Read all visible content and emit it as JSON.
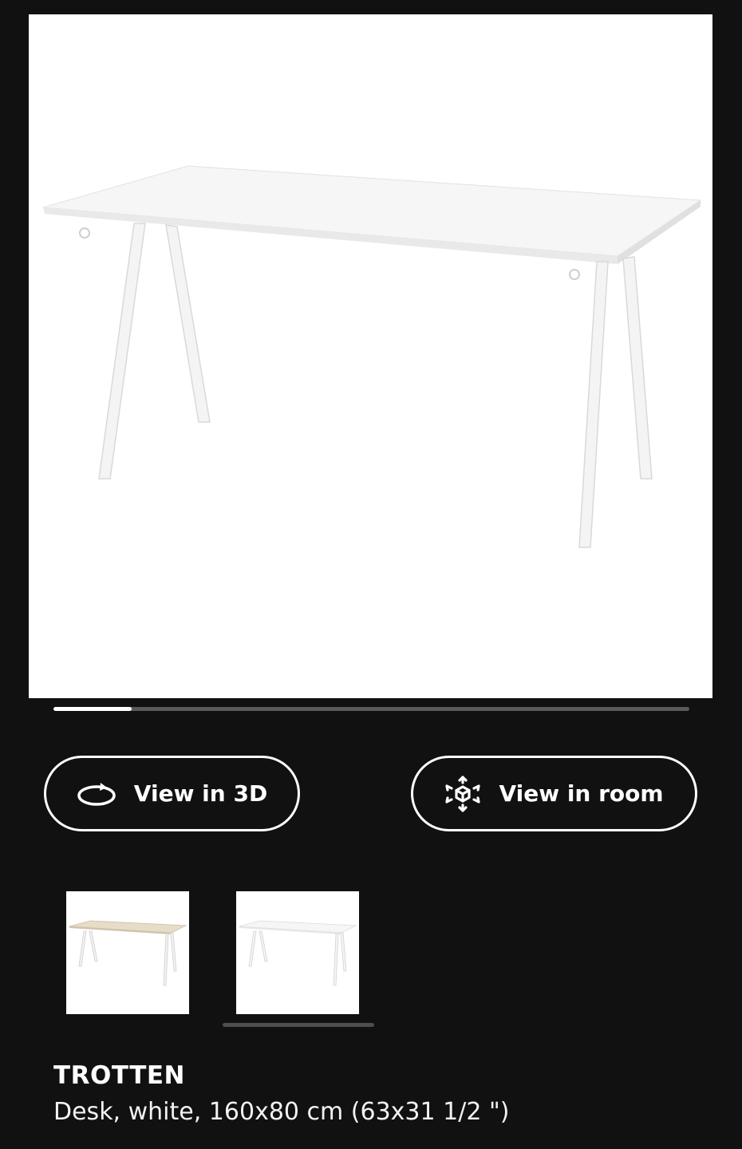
{
  "gallery": {
    "progress_fraction": 0.123,
    "hero_image_alt": "desk-photo-white"
  },
  "actions": {
    "view_3d_label": "View in 3D",
    "view_room_label": "View in room"
  },
  "thumbnails": [
    {
      "alt": "desk-beige-white-thumbnail",
      "top_color": "#e7dcc8"
    },
    {
      "alt": "desk-white-thumbnail",
      "top_color": "#f4f4f4"
    }
  ],
  "product": {
    "name": "TROTTEN",
    "description": "Desk, white, 160x80 cm (63x31 1/2 \")"
  },
  "colors": {
    "background": "#111111",
    "accent": "#ffffff",
    "track": "#5a5a5a"
  },
  "icons": {
    "view_3d": "rotate-360-icon",
    "view_room": "ar-cube-icon"
  }
}
